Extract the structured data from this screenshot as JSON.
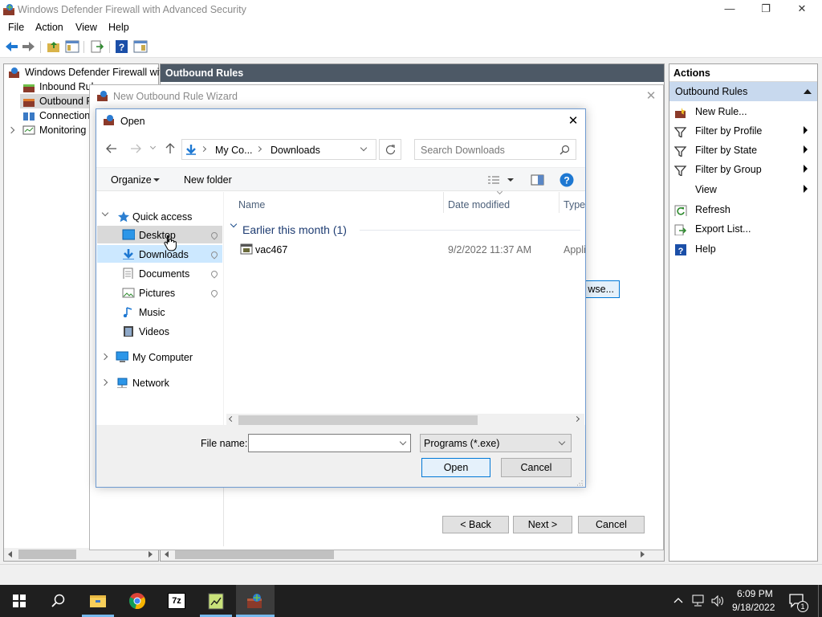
{
  "window": {
    "title": "Windows Defender Firewall with Advanced Security",
    "minimize": "—",
    "maximize": "❐",
    "close": "✕"
  },
  "menu": [
    "File",
    "Action",
    "View",
    "Help"
  ],
  "tree": {
    "root": "Windows Defender Firewall witl",
    "items": [
      "Inbound Rul",
      "Outbound R",
      "Connection",
      "Monitoring"
    ]
  },
  "center": {
    "header": "Outbound Rules",
    "browse_partial": "wse..."
  },
  "actions": {
    "header": "Actions",
    "section": "Outbound Rules",
    "items": [
      "New Rule...",
      "Filter by Profile",
      "Filter by State",
      "Filter by Group",
      "View",
      "Refresh",
      "Export List...",
      "Help"
    ]
  },
  "wizard": {
    "title": "New Outbound Rule Wizard",
    "back": "< Back",
    "next": "Next >",
    "cancel": "Cancel"
  },
  "open_dialog": {
    "title": "Open",
    "breadcrumb": [
      "My Co...",
      "Downloads"
    ],
    "search_placeholder": "Search Downloads",
    "organize": "Organize",
    "new_folder": "New folder",
    "nav": {
      "quick_access": "Quick access",
      "items": [
        "Desktop",
        "Downloads",
        "Documents",
        "Pictures",
        "Music",
        "Videos"
      ],
      "my_computer": "My Computer",
      "network": "Network"
    },
    "columns": [
      "Name",
      "Date modified",
      "Type"
    ],
    "group": "Earlier this month (1)",
    "files": [
      {
        "name": "vac467",
        "date": "9/2/2022 11:37 AM",
        "type": "Appli"
      }
    ],
    "file_name_label": "File name:",
    "file_name_value": "",
    "filter": "Programs (*.exe)",
    "open": "Open",
    "cancel": "Cancel"
  },
  "taskbar": {
    "time": "6:09 PM",
    "date": "9/18/2022",
    "notification_count": "1"
  },
  "colors": {
    "accent": "#0078d7",
    "header_bg": "#4d5966",
    "selection": "#cce8ff",
    "taskbar": "#1f1f1f"
  }
}
